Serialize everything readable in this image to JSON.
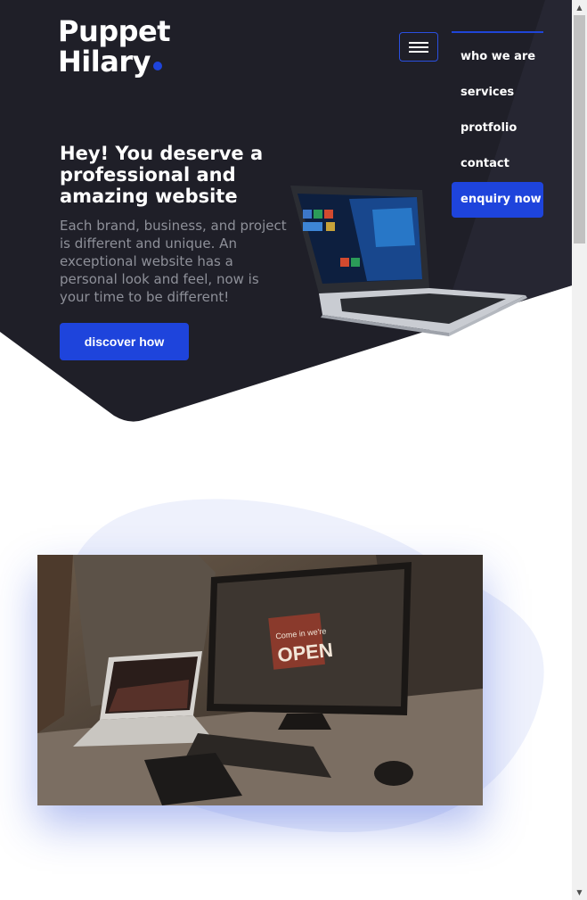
{
  "colors": {
    "hero_bg": "#1f1f28",
    "accent": "#1e44dc",
    "blob": "#eef1fc"
  },
  "header": {
    "logo_line1": "Puppet",
    "logo_line2": "Hilary",
    "menu_icon": "hamburger-icon"
  },
  "nav": {
    "items": [
      {
        "label": "who we are"
      },
      {
        "label": "services"
      },
      {
        "label": "protfolio"
      },
      {
        "label": "contact"
      }
    ],
    "cta_label": "enquiry now"
  },
  "hero": {
    "title": "Hey! You deserve a professional and amazing website",
    "text": "Each brand, business, and project is different and unique. An exceptional website has a personal look and feel, now is your time to be different!",
    "button_label": "discover how"
  },
  "photo": {
    "sign_line1": "Come in we're",
    "sign_line2": "OPEN"
  },
  "scrollbar": {
    "up_icon": "triangle-up-icon",
    "down_icon": "triangle-down-icon"
  }
}
